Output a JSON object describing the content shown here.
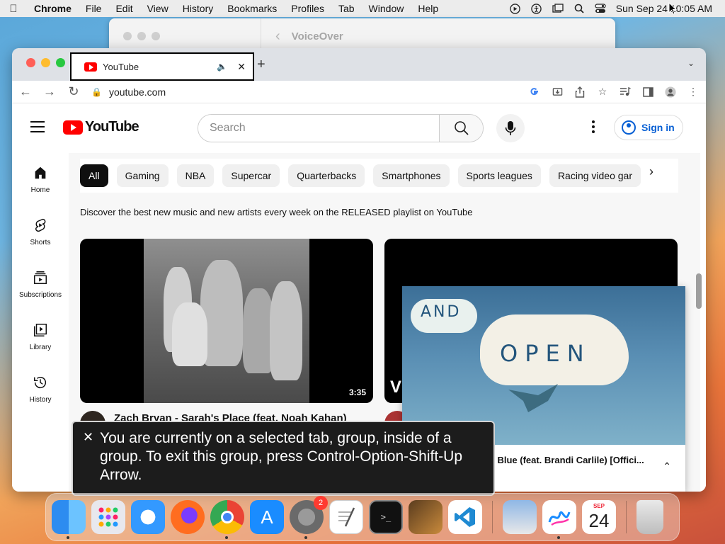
{
  "menubar": {
    "app": "Chrome",
    "menus": [
      "File",
      "Edit",
      "View",
      "History",
      "Bookmarks",
      "Profiles",
      "Tab",
      "Window",
      "Help"
    ],
    "clock": "Sun Sep 24  10:05 AM"
  },
  "voiceover_window": {
    "title": "VoiceOver"
  },
  "browser": {
    "tab_title": "YouTube",
    "url": "youtube.com"
  },
  "youtube": {
    "logo_text": "YouTube",
    "search_placeholder": "Search",
    "signin_label": "Sign in",
    "guide": [
      {
        "label": "Home",
        "icon": "home-icon"
      },
      {
        "label": "Shorts",
        "icon": "shorts-icon"
      },
      {
        "label": "Subscriptions",
        "icon": "subscriptions-icon"
      },
      {
        "label": "Library",
        "icon": "library-icon"
      },
      {
        "label": "History",
        "icon": "history-icon"
      }
    ],
    "chips": [
      "All",
      "Gaming",
      "NBA",
      "Supercar",
      "Quarterbacks",
      "Smartphones",
      "Sports leagues",
      "Racing video gar"
    ],
    "promo_text": "Discover the best new music and new artists every week on the RELEASED playlist on YouTube",
    "videos": [
      {
        "title": "Zach Bryan - Sarah's Place (feat. Noah Kahan)",
        "duration": "3:35"
      },
      {
        "letter": "V"
      }
    ],
    "mini_player": {
      "title": "le Blue (feat. Brandi Carlile) [Offici...",
      "art_text_1": "AND",
      "art_text_2": "OPEN"
    }
  },
  "voiceover_caption": "You are currently on a selected tab, group, inside of a group.  To exit this group, press Control-Option-Shift-Up Arrow.",
  "dock": {
    "apps": [
      "Finder",
      "Launchpad",
      "Safari",
      "Firefox",
      "Chrome",
      "App Store",
      "System Settings",
      "TextEdit",
      "Terminal",
      "GarageBand",
      "VS Code",
      "Preview",
      "Freeform",
      "Calendar",
      "Trash"
    ],
    "settings_badge": "2",
    "calendar_month": "SEP",
    "calendar_day": "24"
  },
  "colors": {
    "yt_red": "#ff0000",
    "link_blue": "#065fd4",
    "chip_active": "#0f0f0f"
  }
}
